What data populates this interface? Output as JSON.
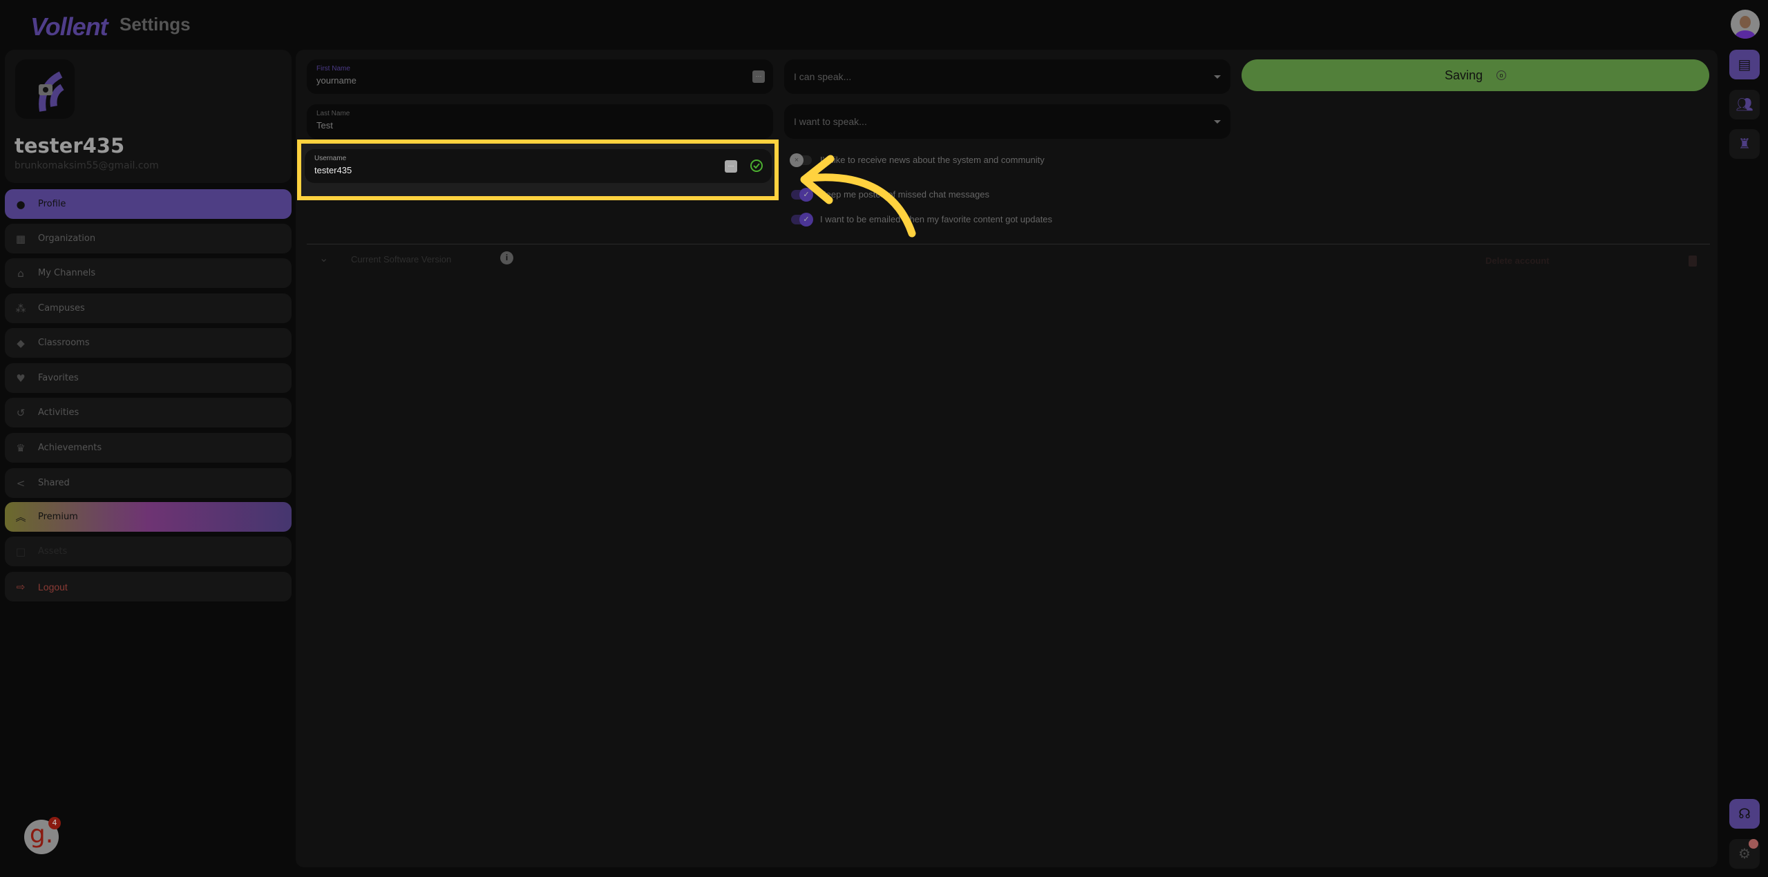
{
  "header": {
    "logo": "Vollent",
    "title": "Settings"
  },
  "profile": {
    "username": "tester435",
    "email": "brunkomaksim55@gmail.com"
  },
  "sidebar": {
    "items": [
      {
        "label": "Profile",
        "icon": "account-circle-icon"
      },
      {
        "label": "Organization",
        "icon": "building-icon"
      },
      {
        "label": "My Channels",
        "icon": "home-icon"
      },
      {
        "label": "Campuses",
        "icon": "group-icon"
      },
      {
        "label": "Classrooms",
        "icon": "school-icon"
      },
      {
        "label": "Favorites",
        "icon": "heart-icon"
      },
      {
        "label": "Activities",
        "icon": "history-icon"
      },
      {
        "label": "Achievements",
        "icon": "trophy-icon"
      },
      {
        "label": "Shared",
        "icon": "share-icon"
      },
      {
        "label": "Premium",
        "icon": "double-chevron-up-icon"
      },
      {
        "label": "Assets",
        "icon": "square-icon"
      },
      {
        "label": "Logout",
        "icon": "logout-icon"
      }
    ]
  },
  "form": {
    "first_name": {
      "label": "First Name",
      "value": "yourname"
    },
    "last_name": {
      "label": "Last Name",
      "value": "Test"
    },
    "username": {
      "label": "Username",
      "value": "tester435"
    },
    "can_speak": {
      "placeholder": "I can speak..."
    },
    "want_speak": {
      "placeholder": "I want to speak..."
    },
    "save_label": "Saving",
    "toggles": [
      {
        "label": "I'd like to receive news about the system and community",
        "on": false
      },
      {
        "label": "Keep me posted of missed chat messages",
        "on": true
      },
      {
        "label": "I want to be emailed when my favorite content got updates",
        "on": true
      }
    ]
  },
  "footer": {
    "version_label": "Current Software Version",
    "delete_label": "Delete account"
  },
  "widget": {
    "badge": "4",
    "letter": "g."
  },
  "colors": {
    "accent": "#4e3e84",
    "save": "#52803a",
    "highlight": "#ffd23f",
    "danger": "#8a3b35"
  }
}
